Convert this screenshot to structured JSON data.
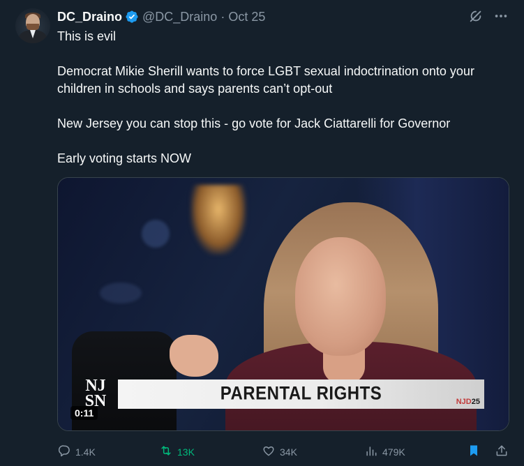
{
  "author": {
    "name": "DC_Draino",
    "handle": "@DC_Draino",
    "separator": "·",
    "date": "Oct 25",
    "verified": true
  },
  "icons": {
    "verified": "verified-badge-icon",
    "grok": "grok-icon",
    "more": "more-options-icon",
    "reply": "reply-icon",
    "repost": "repost-icon",
    "like": "like-icon",
    "views": "views-icon",
    "bookmark": "bookmark-icon",
    "share": "share-icon"
  },
  "tweet": {
    "paragraphs": [
      "This is evil",
      "Democrat Mikie Sherill wants to force LGBT sexual indoctrination onto your children in schools and says parents can’t opt-out",
      "New Jersey you can stop this - go vote for Jack Ciattarelli for Governor",
      "Early voting starts NOW"
    ]
  },
  "media": {
    "type": "video",
    "duration": "0:11",
    "lower_third": "PARENTAL RIGHTS",
    "logo_line1": "NJ",
    "logo_line2": "SN",
    "tag_prefix": "NJD",
    "tag_suffix": "25"
  },
  "metrics": {
    "replies": "1.4K",
    "reposts": "13K",
    "likes": "34K",
    "views": "479K"
  },
  "colors": {
    "background": "#15202b",
    "text_primary": "#f7f9f9",
    "text_secondary": "#8b98a5",
    "verified_blue": "#1d9bf0",
    "repost_green": "#00ba7c",
    "bookmark_blue": "#1d9bf0"
  }
}
